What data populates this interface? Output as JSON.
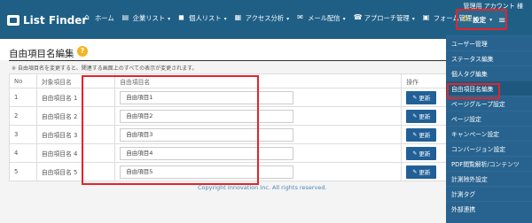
{
  "header": {
    "brand": "List Finder",
    "account": "管理用 アカウント 様",
    "settings_label": "設定",
    "nav": [
      {
        "label": "ホーム"
      },
      {
        "label": "企業リスト"
      },
      {
        "label": "個人リスト"
      },
      {
        "label": "アクセス分析"
      },
      {
        "label": "メール配信"
      },
      {
        "label": "アプローチ管理"
      },
      {
        "label": "フォーム管理"
      }
    ]
  },
  "page": {
    "title": "自由項目名編集",
    "note": "自由項目名を変更すると、関連する画面上のすべての表示が変更されます。",
    "columns": [
      "No",
      "対象項目名",
      "自由項目名",
      "操作"
    ],
    "update_label": "更新",
    "rows": [
      {
        "no": "1",
        "name": "自由項目名 1",
        "value": "自由項目1"
      },
      {
        "no": "2",
        "name": "自由項目名 2",
        "value": "自由項目2"
      },
      {
        "no": "3",
        "name": "自由項目名 3",
        "value": "自由項目3"
      },
      {
        "no": "4",
        "name": "自由項目名 4",
        "value": "自由項目4"
      },
      {
        "no": "5",
        "name": "自由項目名 5",
        "value": "自由項目5"
      }
    ],
    "copyright": "Copyright Innovation Inc. All rights reserved."
  },
  "menu": {
    "items": [
      {
        "label": "ユーザー管理"
      },
      {
        "label": "ステータス編集"
      },
      {
        "label": "個人タグ編集"
      },
      {
        "label": "自由項目名編集"
      },
      {
        "label": "ページグループ設定"
      },
      {
        "label": "ページ設定"
      },
      {
        "label": "キャンペーン設定"
      },
      {
        "label": "コンバージョン設定"
      },
      {
        "label": "PDF閲覧解析/コンテンツ"
      },
      {
        "label": "計測除外設定"
      },
      {
        "label": "計測タグ"
      },
      {
        "label": "外部連携"
      }
    ]
  },
  "colors": {
    "topbar": "#1f5f86",
    "accent": "#215f97",
    "highlight": "#e3242b",
    "help": "#f6b321"
  },
  "icons": {
    "help": "help-icon",
    "settings": "gear-icon",
    "menu": "hamburger-menu-icon",
    "edit": "edit-icon"
  }
}
